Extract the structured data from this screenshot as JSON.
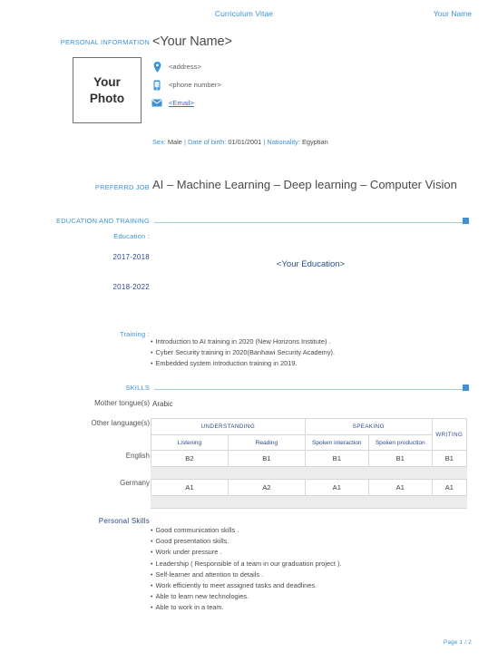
{
  "header": {
    "center_title": "Curriculum Vitae",
    "right_title": "Your Name"
  },
  "personal_information": {
    "section_label": "PERSONAL INFORMATION",
    "name": "<Your Name>",
    "photo_placeholder_line1": "Your",
    "photo_placeholder_line2": "Photo",
    "contacts": [
      {
        "icon": "location-pin-icon",
        "text": "<address>",
        "is_link": false
      },
      {
        "icon": "mobile-phone-icon",
        "text": "<phone number>",
        "is_link": false
      },
      {
        "icon": "envelope-icon",
        "text": "<Email>",
        "is_link": true
      }
    ],
    "demographics": {
      "sex_label": "Sex:",
      "sex_value": "Male",
      "sep1": "|",
      "dob_label": "Date of birth:",
      "dob_value": "01/01/2001",
      "sep2": "|",
      "nationality_label": "Nationality:",
      "nationality_value": "Egyptian"
    }
  },
  "preferred_job": {
    "section_label": "PREFERRD JOB",
    "title": "AI – Machine Learning – Deep learning – Computer Vision"
  },
  "education_and_training": {
    "section_label": "EDUCATION AND TRAINING",
    "education_label": "Education :",
    "date_ranges": [
      "2017-2018",
      "2018-2022"
    ],
    "education_placeholder": "<Your Education>",
    "training_label": "Training :",
    "training_items": [
      "Introduction to AI training in 2020 (New Horizons Institute) .",
      "Cyber Security training in 2020(Banhawi Security Academy).",
      "Embedded system introduction training in 2019."
    ]
  },
  "skills": {
    "section_label": "SKILLS",
    "mother_tongue_label": "Mother tongue(s)",
    "mother_tongue_value": "Arabic",
    "other_languages_label": "Other language(s)",
    "table": {
      "group_headers": [
        "UNDERSTANDING",
        "SPEAKING",
        "WRITING"
      ],
      "sub_headers": [
        "Listening",
        "Reading",
        "Spoken interaction",
        "Spoken production"
      ],
      "rows": [
        {
          "language": "English",
          "levels": [
            "B2",
            "B1",
            "B1",
            "B1",
            "B1"
          ]
        },
        {
          "language": "Germany",
          "levels": [
            "A1",
            "A2",
            "A1",
            "A1",
            "A1"
          ]
        }
      ]
    },
    "personal_skills_label": "Personal Skills",
    "personal_skills": [
      "Good communication skills .",
      "Good presentation skills.",
      "Work under pressure .",
      "Leadership ( Responsible of a team in our graduation project ).",
      "Self-learner and attention to details .",
      "Work efficiently to meet assigned tasks and deadlines.",
      "Able to learn new technologies.",
      "Able to work in a team."
    ]
  },
  "footer": {
    "page_indicator": "Page 1 / 2"
  },
  "colors": {
    "accent_blue": "#3c93d4",
    "rule_blue": "#9fcbe8",
    "heading_navy": "#2b4a8b",
    "body_gray": "#4a4a4a",
    "stripe_gray": "#ececec"
  }
}
